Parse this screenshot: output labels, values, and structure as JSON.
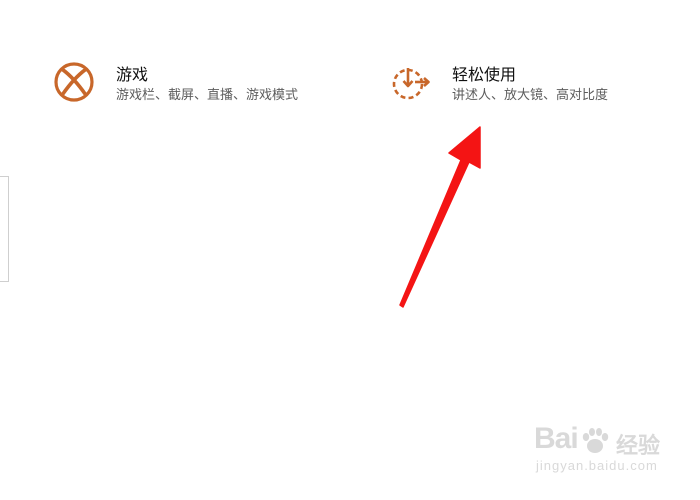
{
  "settings_tiles": [
    {
      "icon": "xbox-icon",
      "title": "游戏",
      "description": "游戏栏、截屏、直播、游戏模式"
    },
    {
      "icon": "ease-of-access-icon",
      "title": "轻松使用",
      "description": "讲述人、放大镜、高对比度"
    }
  ],
  "colors": {
    "icon_accent": "#c8672a",
    "annotation_arrow": "#f41414",
    "watermark": "#d9d9d9"
  },
  "watermark": {
    "brand": "Bai",
    "brand_suffix": "经验",
    "url": "jingyan.baidu.com"
  }
}
